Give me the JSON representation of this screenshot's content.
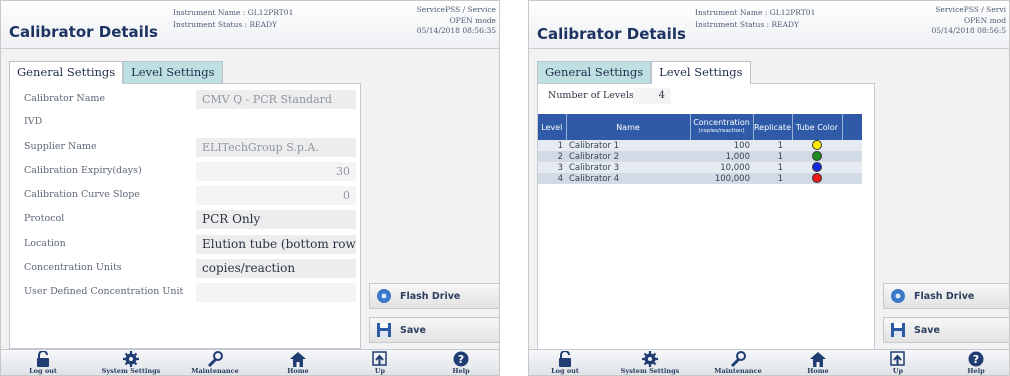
{
  "left": {
    "header": {
      "title": "Calibrator Details",
      "instrument_name": "Instrument Name : GL12PRT01",
      "instrument_status": "Instrument Status : READY",
      "user": "ServicePSS / Service",
      "mode": "OPEN mode",
      "datetime": "05/14/2018 08:56:35"
    },
    "tabs": [
      "General Settings",
      "Level Settings"
    ],
    "fields": [
      {
        "label": "Calibrator Name",
        "value": "CMV Q - PCR Standard"
      },
      {
        "label": "IVD",
        "value": ""
      },
      {
        "label": "Supplier Name",
        "value": "ELITechGroup S.p.A."
      },
      {
        "label": "Calibration Expiry(days)",
        "value": "30"
      },
      {
        "label": "Calibration Curve Slope",
        "value": "0"
      },
      {
        "label": "Protocol",
        "value": "PCR Only"
      },
      {
        "label": "Location",
        "value": "Elution tube (bottom row)"
      },
      {
        "label": "Concentration Units",
        "value": "copies/reaction"
      },
      {
        "label": "User Defined Concentration Unit",
        "value": ""
      }
    ],
    "buttons": {
      "flash_drive": "Flash Drive",
      "save": "Save"
    }
  },
  "right": {
    "header": {
      "title": "Calibrator Details",
      "instrument_name": "Instrument Name : GL12PRT01",
      "instrument_status": "Instrument Status : READY",
      "user": "ServicePSS / Servi",
      "mode": "OPEN mod",
      "datetime": "05/14/2018 08:56:5"
    },
    "tabs": [
      "General Settings",
      "Level Settings"
    ],
    "number_of_levels_label": "Number of Levels",
    "number_of_levels": "4",
    "table": {
      "headers": [
        "Level",
        "Name",
        "Concentration",
        "(copies/reaction)",
        "Replicate",
        "Tube Color"
      ],
      "rows": [
        {
          "level": "1",
          "name": "Calibrator 1",
          "concentration": "100",
          "replicate": "1",
          "tube_color": "#ffee00"
        },
        {
          "level": "2",
          "name": "Calibrator 2",
          "concentration": "1,000",
          "replicate": "1",
          "tube_color": "#1e8c1e"
        },
        {
          "level": "3",
          "name": "Calibrator 3",
          "concentration": "10,000",
          "replicate": "1",
          "tube_color": "#1428e0"
        },
        {
          "level": "4",
          "name": "Calibrator 4",
          "concentration": "100,000",
          "replicate": "1",
          "tube_color": "#ee1a1a"
        }
      ]
    },
    "buttons": {
      "flash_drive": "Flash Drive",
      "save": "Save"
    }
  },
  "footer": {
    "items": [
      "Log out",
      "System Settings",
      "Maintenance",
      "Home",
      "Up",
      "Help"
    ]
  }
}
